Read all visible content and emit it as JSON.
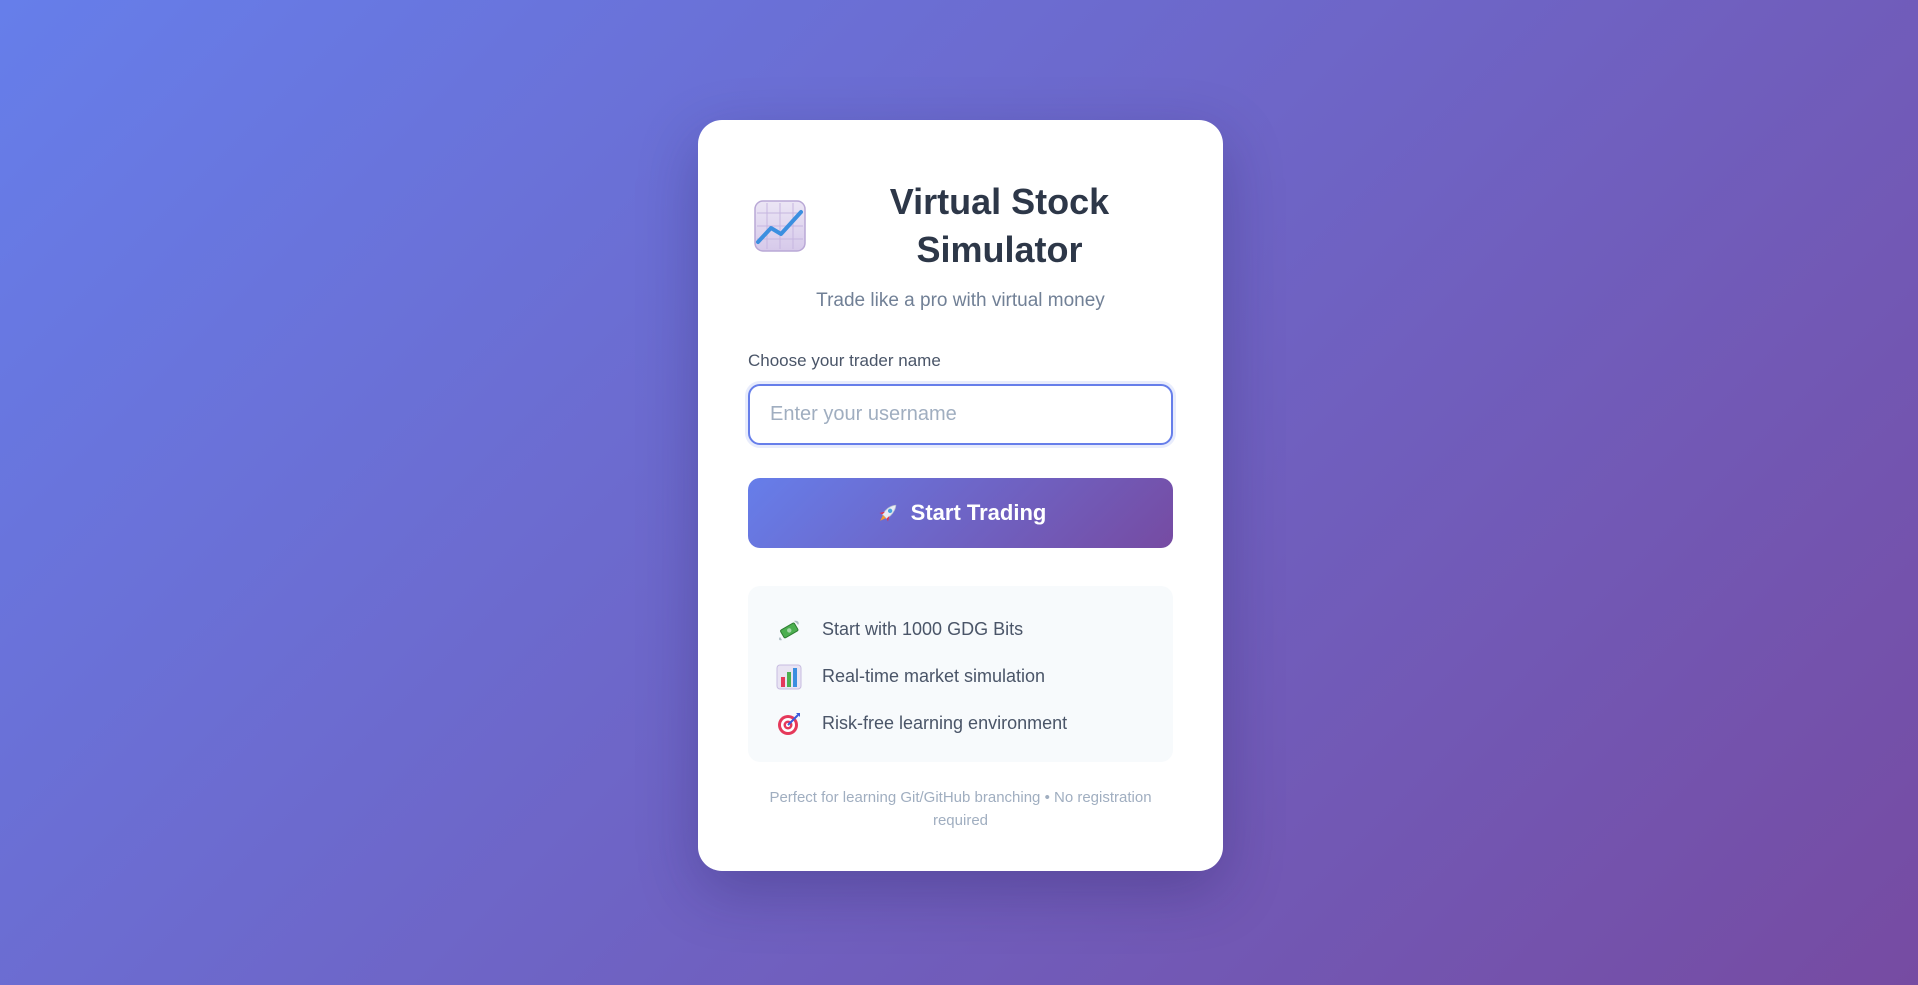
{
  "header": {
    "logo_icon": "chart-increasing-icon",
    "title": "Virtual Stock Simulator",
    "subtitle": "Trade like a pro with virtual money"
  },
  "form": {
    "label": "Choose your trader name",
    "username_placeholder": "Enter your username",
    "username_value": "",
    "start_button_icon": "rocket-icon",
    "start_button_label": "Start Trading"
  },
  "features": [
    {
      "icon": "money-with-wings-icon",
      "text": "Start with 1000 GDG Bits"
    },
    {
      "icon": "bar-chart-icon",
      "text": "Real-time market simulation"
    },
    {
      "icon": "direct-hit-target-icon",
      "text": "Risk-free learning environment"
    }
  ],
  "footer": {
    "text": "Perfect for learning Git/GitHub branching • No registration required"
  },
  "colors": {
    "gradient_start": "#667eea",
    "gradient_end": "#764ba2",
    "title": "#2d3748",
    "muted": "#718096"
  }
}
